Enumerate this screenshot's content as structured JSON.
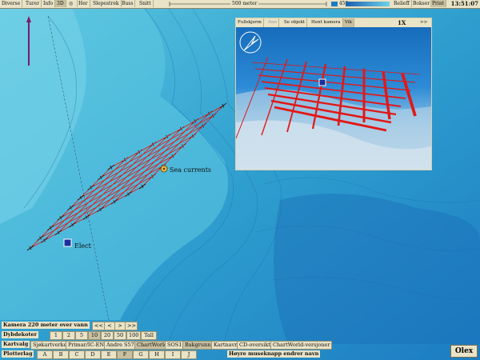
{
  "top_toolbar": {
    "buttons": [
      "Diverse",
      "Turer",
      "Info",
      "3D",
      "Her",
      "Slepestrek",
      "Buss",
      "Snitt"
    ],
    "selected": "3D",
    "scale_label": "500 meter",
    "depth_value": "450",
    "right_buttons": [
      "Relieff",
      "Bokser",
      "Print"
    ],
    "time": "13:51:07"
  },
  "inset": {
    "buttons": [
      "Fullskjerm",
      "Ann",
      "Se objekt",
      "Hent kamera",
      "Vik"
    ],
    "selected": "Vik",
    "zoom": "1X",
    "nav": ">>"
  },
  "map_labels": {
    "current": "Sea currents",
    "vessel": "Elect"
  },
  "camera_row": {
    "label": "Kamera 220 meter over vann",
    "nav": [
      "<<",
      "<",
      ">",
      ">>"
    ]
  },
  "depth_row": {
    "label": "Dybdekoter",
    "values": [
      "1",
      "2",
      "5",
      "10",
      "20",
      "50",
      "100",
      "Tall"
    ],
    "selected": "10"
  },
  "chart_row": {
    "label": "Kartvalg",
    "buttons": [
      "Sjøkartverket",
      "Primar/IC-ENC",
      "Andre S57",
      "ChartWorld",
      "SOS1",
      "Bakgrunn",
      "Kartnavn",
      "CD-oversikt",
      "ChartWorld-versjoner"
    ],
    "selected": [
      "ChartWorld",
      "Bakgrunn"
    ]
  },
  "layer_row": {
    "label": "Plotterlag",
    "buttons": [
      "A",
      "B",
      "C",
      "D",
      "E",
      "F",
      "G",
      "H",
      "I",
      "J"
    ],
    "selected": "F",
    "hint": "Høyre museknapp endrer navn"
  },
  "brand": "Olex",
  "colors": {
    "deep_water": "#37a9cf",
    "shallow_water": "#4fc3df",
    "track": "#e02020",
    "toolbar": "#e9e3c7",
    "vessel": "#1a2f9a"
  }
}
